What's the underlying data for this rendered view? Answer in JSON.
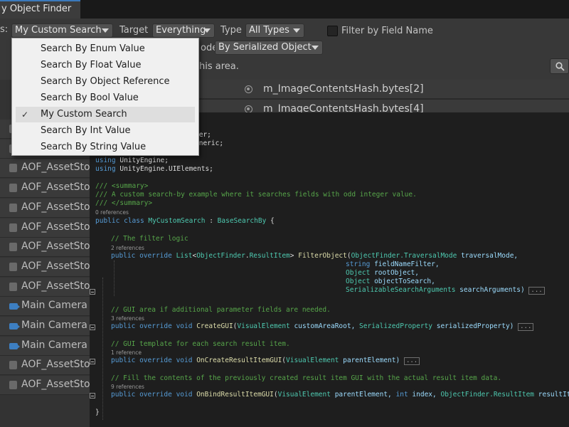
{
  "window": {
    "tab_title": "y Object Finder"
  },
  "toolbar": {
    "search_by_label_tail": "s:",
    "search_by_value": "My Custom Search",
    "target_label": "Target",
    "target_value": "Everything",
    "type_label": "Type",
    "type_value": "All Types",
    "filter_field_label": "Filter by Field Name",
    "mode_label_tail": "ode",
    "mode_value": "By Serialized Object",
    "hint_tail": "his area."
  },
  "menu": {
    "items": [
      {
        "label": "Search By Enum Value",
        "checked": false
      },
      {
        "label": "Search By Float Value",
        "checked": false
      },
      {
        "label": "Search By Object Reference",
        "checked": false
      },
      {
        "label": "Search By Bool Value",
        "checked": false
      },
      {
        "label": "My Custom Search",
        "checked": true
      },
      {
        "label": "Search By Int Value",
        "checked": false
      },
      {
        "label": "Search By String Value",
        "checked": false
      }
    ],
    "check_glyph": "✓"
  },
  "results": {
    "right_rows": [
      "m_ImageContentsHash.bytes[2]",
      "m_ImageContentsHash.bytes[4]"
    ],
    "right_prefix": "<",
    "left_rows": [
      "AOF_AssetStor",
      "AOF_AssetStor",
      "AOF_AssetStor",
      "AOF_AssetStor",
      "AOF_AssetStor",
      "AOF_AssetStor",
      "AOF_AssetStor",
      "AOF_AssetStor",
      "AOF_AssetStor",
      "Main Camera (",
      "Main Camera (",
      "Main Camera (",
      "AOF_AssetStor",
      "AOF_AssetStor"
    ]
  },
  "code": {
    "frag1": "der;",
    "frag2": "eneric;",
    "using1_kw": "using",
    "using1_ns": "UnityEngine;",
    "using2_kw": "using",
    "using2_ns": "UnityEngine.UIElements;",
    "summary_open": "/// <summary>",
    "summary_text": "/// A custom search-by example where it searches fields with odd integer value.",
    "summary_close": "/// </summary>",
    "refs0": "0 references",
    "class_public": "public",
    "class_kw": "class",
    "class_name": "MyCustomSearch",
    "class_colon": " : ",
    "class_base": "BaseSearchBy",
    "class_brace": " {",
    "c_filter": "// The filter logic",
    "refs2": "2 references",
    "f_public": "public",
    "f_override": "override",
    "f_list": "List",
    "f_lt": "<",
    "f_of": "ObjectFinder",
    "f_dot": ".",
    "f_ri": "ResultItem",
    "f_gt": ">",
    "f_name": "FilterObject",
    "f_p1t": "ObjectFinder.TraversalMode",
    "f_p1n": "traversalMode,",
    "f_p2t": "string",
    "f_p2n": "fieldNameFilter,",
    "f_p3t": "Object",
    "f_p3n": "rootObject,",
    "f_p4t": "Object",
    "f_p4n": "objectToSearch,",
    "f_p5t": "SerializableSearchArguments",
    "f_p5n": "searchArguments)",
    "ellipsis": "...",
    "c_gui": "// GUI area if additional parameter fields are needed.",
    "refs3": "3 references",
    "g_public": "public",
    "g_override": "override",
    "g_void": "void",
    "g_name": "CreateGUI",
    "g_p1t": "VisualElement",
    "g_p1n": "customAreaRoot,",
    "g_p2t": "SerializedProperty",
    "g_p2n": "serializedProperty)",
    "c_tpl": "// GUI template for each search result item.",
    "refs1": "1 reference",
    "t_public": "public",
    "t_override": "override",
    "t_void": "void",
    "t_name": "OnCreateResultItemGUI",
    "t_p1t": "VisualElement",
    "t_p1n": "parentElement)",
    "c_fill": "// Fill the contents of the previously created result item GUI with the actual result item data.",
    "refs9": "9 references",
    "b_public": "public",
    "b_override": "override",
    "b_void": "void",
    "b_name": "OnBindResultItemGUI",
    "b_p1t": "VisualElement",
    "b_p1n": "parentElement,",
    "b_p2t": "int",
    "b_p2n": "index,",
    "b_p3t": "ObjectFinder.ResultItem",
    "b_p3n": "resultIte",
    "close_brace": "}"
  },
  "colors": {
    "accent": "#3a79bb",
    "keyword": "#569cd6",
    "type": "#4ec9b0",
    "comment": "#57a64a",
    "param": "#9cdcfe",
    "method": "#dcdcaa"
  }
}
